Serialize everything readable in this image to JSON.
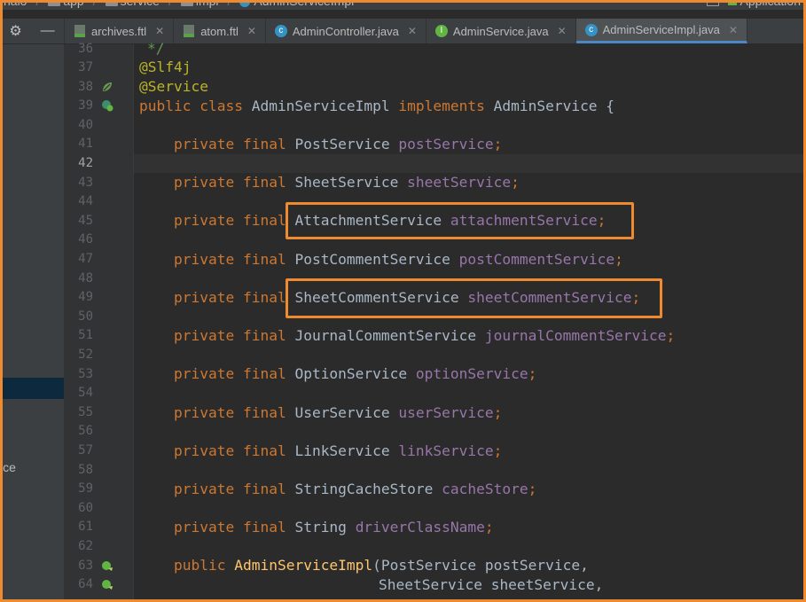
{
  "breadcrumb": {
    "items": [
      "halo",
      "app",
      "service",
      "impl",
      "AdminServiceImpl"
    ],
    "run_config": "Application"
  },
  "tabs": [
    {
      "label": "archives.ftl",
      "icon": "ftl-file-icon",
      "active": false
    },
    {
      "label": "atom.ftl",
      "icon": "ftl-file-icon",
      "active": false
    },
    {
      "label": "AdminController.java",
      "icon": "class-icon",
      "active": false
    },
    {
      "label": "AdminService.java",
      "icon": "interface-icon",
      "active": false
    },
    {
      "label": "AdminServiceImpl.java",
      "icon": "class-icon",
      "active": true
    }
  ],
  "sidebar": {
    "partial_label": "ice"
  },
  "editor": {
    "current_line": "42",
    "line_numbers": [
      "36",
      "37",
      "38",
      "39",
      "40",
      "41",
      "42",
      "43",
      "44",
      "45",
      "46",
      "47",
      "48",
      "49",
      "50",
      "51",
      "52",
      "53",
      "54",
      "55",
      "56",
      "57",
      "58",
      "59",
      "60",
      "61",
      "62",
      "63",
      "64"
    ],
    "code": {
      "l36": "*/",
      "l37": "@Slf4j",
      "l38": "@Service",
      "l39_kw": "public class",
      "l39_name": "AdminServiceImpl",
      "l39_impl": "implements",
      "l39_rest": "AdminService {",
      "modifiers": "private final",
      "fields": [
        {
          "type": "PostService",
          "name": "postService"
        },
        {
          "type": "SheetService",
          "name": "sheetService"
        },
        {
          "type": "AttachmentService",
          "name": "attachmentService"
        },
        {
          "type": "PostCommentService",
          "name": "postCommentService"
        },
        {
          "type": "SheetCommentService",
          "name": "sheetCommentService"
        },
        {
          "type": "JournalCommentService",
          "name": "journalCommentService"
        },
        {
          "type": "OptionService",
          "name": "optionService"
        },
        {
          "type": "UserService",
          "name": "userService"
        },
        {
          "type": "LinkService",
          "name": "linkService"
        },
        {
          "type": "StringCacheStore",
          "name": "cacheStore"
        },
        {
          "type": "String",
          "name": "driverClassName"
        }
      ],
      "semicolon": ";",
      "l63_kw": "public",
      "l63_name": "AdminServiceImpl",
      "l63_rest": "(PostService postService,",
      "l64": "SheetService sheetService,"
    }
  },
  "colors": {
    "highlight": "#ee8a30",
    "keyword": "#cc7832",
    "field": "#9876aa",
    "annotation": "#bbb529",
    "method": "#ffc66d"
  }
}
